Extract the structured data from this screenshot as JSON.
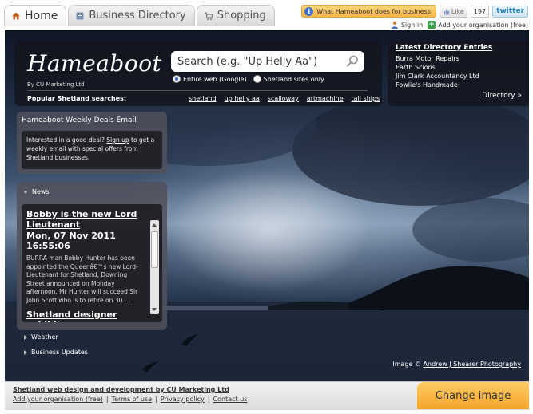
{
  "tabs": [
    {
      "label": "Home",
      "icon": "home-icon"
    },
    {
      "label": "Business Directory",
      "icon": "book-icon"
    },
    {
      "label": "Shopping",
      "icon": "cart-icon"
    }
  ],
  "topbar": {
    "what_label": "What Hameaboot does for business",
    "like_label": "Like",
    "like_count": "197",
    "twitter_label": "twitter",
    "sign_in": "Sign in",
    "add_org": "Add your organisation (free)"
  },
  "header": {
    "logo": "Hameaboot",
    "byline": "By CU Marketing Ltd",
    "search_placeholder": "Search (e.g. \"Up Helly Aa\")",
    "radio_web": "Entire web (Google)",
    "radio_shetland": "Shetland sites only",
    "popular_label": "Popular Shetland searches:",
    "popular_links": [
      "shetland",
      "up helly aa",
      "scalloway",
      "artmachine",
      "tall ships"
    ]
  },
  "directory": {
    "title": "Latest Directory Entries",
    "entries": [
      "Burra Motor Repairs",
      "Earth Scions",
      "Jim Clark Accountancy Ltd",
      "Fowlie's Handmade"
    ],
    "link": "Directory »"
  },
  "deals": {
    "title": "Hameaboot Weekly Deals Email",
    "text_before": "Interested in a good deal?",
    "signup": "Sign up",
    "text_after": "to get a weekly email with special offers from Shetland businesses."
  },
  "news": {
    "section_label": "News",
    "headline": "Bobby is the new Lord Lieutenant",
    "date": "Mon, 07 Nov 2011 16:55:06",
    "body": "BURRA man Bobby Hunter has been appointed the Queenâ€™s new Lord-Lieutenant for Shetland, Downing Street announced on Monday afternoon. Mr Hunter will succeed Sir John Scott who is to retire on 30 …",
    "next_headline": "Shetland designer exhibits"
  },
  "sections": {
    "weather": "Weather",
    "business_updates": "Business Updates"
  },
  "credit": {
    "prefix": "Image ©",
    "author": "Andrew J Shearer Photography"
  },
  "footer": {
    "tagline": "Shetland web design and development by CU Marketing Ltd",
    "links": [
      "Add your organisation (free)",
      "Terms of use",
      "Privacy policy",
      "Contact us"
    ],
    "change_image": "Change image"
  },
  "colors": {
    "accent_orange": "#f3a428",
    "panel_dark": "#14161e",
    "link_blue": "#2a5bb8"
  }
}
